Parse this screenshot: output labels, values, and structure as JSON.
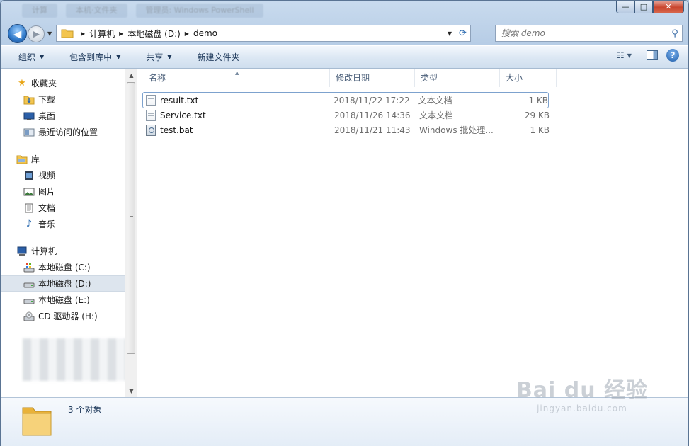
{
  "titlebar": {
    "ghost_tabs": [
      "计算",
      "本机·文件夹",
      "管理员: Windows PowerShell"
    ],
    "minimize": "—",
    "maximize": "□",
    "close": "✕"
  },
  "address": {
    "crumbs": [
      "计算机",
      "本地磁盘 (D:)",
      "demo"
    ]
  },
  "search": {
    "placeholder": "搜索 demo"
  },
  "toolbar": {
    "organize": "组织",
    "include_in_library": "包含到库中",
    "share": "共享",
    "new_folder": "新建文件夹"
  },
  "nav": {
    "favorites": {
      "label": "收藏夹",
      "items": [
        "下载",
        "桌面",
        "最近访问的位置"
      ]
    },
    "libraries": {
      "label": "库",
      "items": [
        "视频",
        "图片",
        "文档",
        "音乐"
      ]
    },
    "computer": {
      "label": "计算机",
      "items": [
        "本地磁盘 (C:)",
        "本地磁盘 (D:)",
        "本地磁盘 (E:)",
        "CD 驱动器 (H:)"
      ]
    }
  },
  "columns": {
    "name": "名称",
    "date": "修改日期",
    "type": "类型",
    "size": "大小"
  },
  "files": [
    {
      "name": "result.txt",
      "date": "2018/11/22 17:22",
      "type": "文本文档",
      "size": "1 KB",
      "icon": "text-file-icon"
    },
    {
      "name": "Service.txt",
      "date": "2018/11/26 14:36",
      "type": "文本文档",
      "size": "29 KB",
      "icon": "text-file-icon"
    },
    {
      "name": "test.bat",
      "date": "2018/11/21 11:43",
      "type": "Windows 批处理...",
      "size": "1 KB",
      "icon": "batch-file-icon"
    }
  ],
  "details": {
    "count": "3 个对象"
  },
  "watermark": {
    "main": "Bai du 经验",
    "sub": "jingyan.baidu.com"
  },
  "colors": {
    "accent": "#1e395b",
    "selection": "#dde5ee",
    "folder": "#f3c54f"
  }
}
